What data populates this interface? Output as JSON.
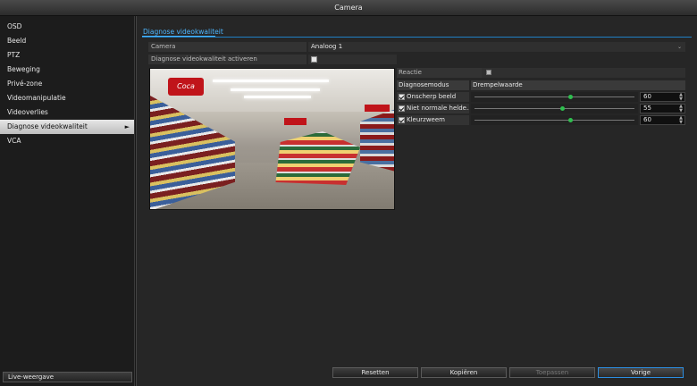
{
  "window": {
    "title": "Camera"
  },
  "sidebar": {
    "items": [
      {
        "label": "OSD"
      },
      {
        "label": "Beeld"
      },
      {
        "label": "PTZ"
      },
      {
        "label": "Beweging"
      },
      {
        "label": "Privé-zone"
      },
      {
        "label": "Videomanipulatie"
      },
      {
        "label": "Videoverlies"
      },
      {
        "label": "Diagnose videokwaliteit",
        "active": true
      },
      {
        "label": "VCA"
      }
    ],
    "live_button": "Live-weergave"
  },
  "tab": {
    "label": "Diagnose videokwaliteit"
  },
  "form": {
    "camera_label": "Camera",
    "camera_value": "Analoog 1",
    "enable_label": "Diagnose videokwaliteit activeren",
    "enable_checked": false,
    "reactie_label": "Reactie"
  },
  "preview": {
    "sign_text": "Coca"
  },
  "diagnostics": {
    "header_mode": "Diagnosemodus",
    "header_threshold": "Drempelwaarde",
    "rows": [
      {
        "label": "Onscherp beeld",
        "checked": true,
        "value": "60",
        "level": 0.6
      },
      {
        "label": "Niet normale helde...",
        "checked": true,
        "value": "55",
        "level": 0.55
      },
      {
        "label": "Kleurzweem",
        "checked": true,
        "value": "60",
        "level": 0.6
      }
    ]
  },
  "buttons": {
    "reset": "Resetten",
    "copy": "Kopiëren",
    "apply": "Toepassen",
    "back": "Vorige"
  },
  "colors": {
    "accent": "#4db6ff",
    "slider_thumb": "#2fbf4f"
  }
}
